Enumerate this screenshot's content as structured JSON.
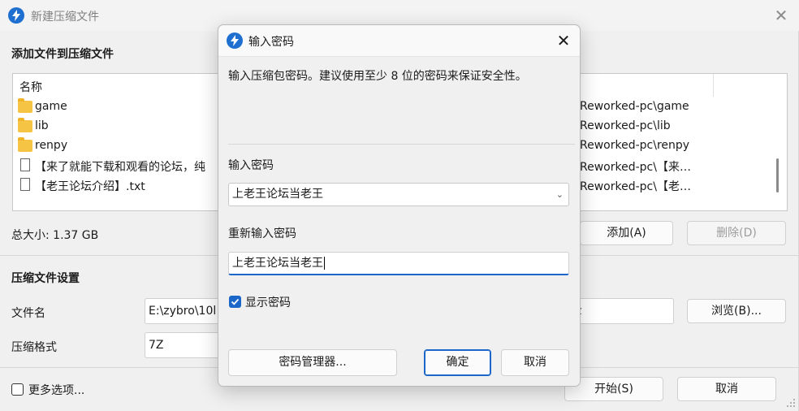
{
  "main_window": {
    "title": "新建压缩文件",
    "add_section_heading": "添加文件到压缩文件",
    "list_header": "名称",
    "files": [
      {
        "type": "folder",
        "name": "game",
        "path": "Reworked-pc\\game"
      },
      {
        "type": "folder",
        "name": "lib",
        "path": "Reworked-pc\\lib"
      },
      {
        "type": "folder",
        "name": "renpy",
        "path": "Reworked-pc\\renpy"
      },
      {
        "type": "file",
        "name": "【来了就能下载和观看的论坛，纯",
        "path": "Reworked-pc\\【来…"
      },
      {
        "type": "file",
        "name": "【老王论坛介绍】.txt",
        "path": "Reworked-pc\\【老…"
      }
    ],
    "total_size": "总大小: 1.37 GB",
    "add_button": "添加(A)",
    "delete_button": "删除(D)",
    "settings_heading": "压缩文件设置",
    "filename_label": "文件名",
    "filename_value": "E:\\zybro\\10l",
    "filename_suffix": "z",
    "browse_button": "浏览(B)...",
    "format_label": "压缩格式",
    "format_value": "7Z",
    "more_options": "更多选项...",
    "start_button": "开始(S)",
    "cancel_button": "取消"
  },
  "dialog": {
    "title": "输入密码",
    "description": "输入压缩包密码。建议使用至少 8 位的密码来保证安全性。",
    "password_label": "输入密码",
    "password_value": "上老王论坛当老王",
    "reenter_label": "重新输入密码",
    "reenter_value": "上老王论坛当老王",
    "show_password": "显示密码",
    "show_password_checked": true,
    "manager_button": "密码管理器...",
    "ok_button": "确定",
    "cancel_button": "取消"
  },
  "colors": {
    "accent": "#1a66c9",
    "folder": "#f6c445"
  }
}
